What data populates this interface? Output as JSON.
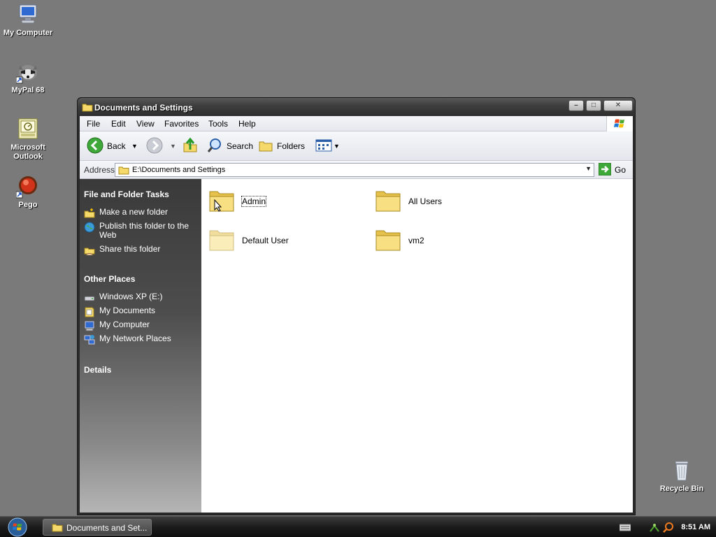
{
  "desktop": {
    "icons": [
      {
        "label": "My Computer",
        "icon": "monitor-icon"
      },
      {
        "label": "MyPal 68",
        "icon": "raccoon-icon"
      },
      {
        "label": "Microsoft Outlook",
        "icon": "outlook-icon"
      },
      {
        "label": "Pego",
        "icon": "pego-icon"
      },
      {
        "label": "Recycle Bin",
        "icon": "recycle-bin-icon"
      }
    ]
  },
  "window": {
    "title": "Documents and Settings",
    "buttons": {
      "minimize": "–",
      "maximize": "□",
      "close": "✕"
    },
    "menu": [
      "File",
      "Edit",
      "View",
      "Favorites",
      "Tools",
      "Help"
    ],
    "toolbar": {
      "back": "Back",
      "search": "Search",
      "folders": "Folders"
    },
    "address": {
      "label": "Address",
      "value": "E:\\Documents and Settings",
      "go": "Go"
    },
    "tasks": {
      "title": "File and Folder Tasks",
      "items": [
        {
          "label": "Make a new folder",
          "icon": "new-folder-icon"
        },
        {
          "label": "Publish this folder to the Web",
          "icon": "globe-icon"
        },
        {
          "label": "Share this folder",
          "icon": "share-folder-icon"
        }
      ]
    },
    "other_places": {
      "title": "Other Places",
      "items": [
        {
          "label": "Windows XP (E:)",
          "icon": "drive-icon"
        },
        {
          "label": "My Documents",
          "icon": "documents-icon"
        },
        {
          "label": "My Computer",
          "icon": "computer-icon"
        },
        {
          "label": "My Network Places",
          "icon": "network-icon"
        }
      ]
    },
    "details": {
      "title": "Details"
    },
    "folders": [
      {
        "name": "Admin"
      },
      {
        "name": "All Users"
      },
      {
        "name": "Default User"
      },
      {
        "name": "vm2"
      }
    ]
  },
  "taskbar": {
    "task_label": "Documents and Set...",
    "clock": "8:51 AM"
  }
}
